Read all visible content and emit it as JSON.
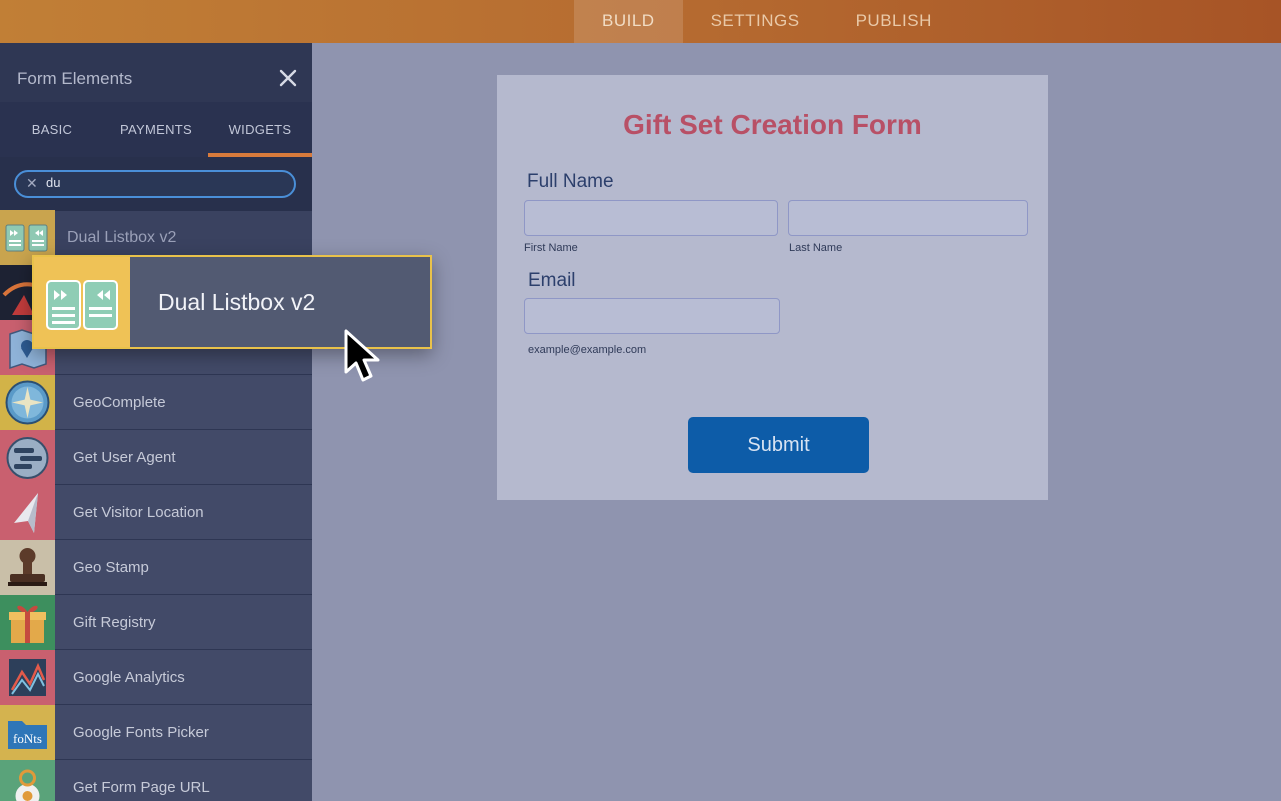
{
  "topnav": {
    "tabs": [
      {
        "label": "BUILD"
      },
      {
        "label": "SETTINGS"
      },
      {
        "label": "PUBLISH"
      }
    ],
    "active": "BUILD"
  },
  "sidebar": {
    "title": "Form Elements",
    "close_icon": "close-icon",
    "tabs": [
      {
        "label": "BASIC"
      },
      {
        "label": "PAYMENTS"
      },
      {
        "label": "WIDGETS"
      }
    ],
    "active_tab": "WIDGETS",
    "search": {
      "value": "du",
      "clear_icon": "clear-icon"
    },
    "items": [
      {
        "label": "Dual Listbox v2",
        "icon": "dual-listbox-icon"
      },
      {
        "label": "",
        "icon": "maps-icon"
      },
      {
        "label": "",
        "icon": "map-pin-icon"
      },
      {
        "label": "GeoComplete",
        "icon": "compass-icon"
      },
      {
        "label": "Get User Agent",
        "icon": "user-agent-icon"
      },
      {
        "label": "Get Visitor Location",
        "icon": "location-arrow-icon"
      },
      {
        "label": "Geo Stamp",
        "icon": "stamp-icon"
      },
      {
        "label": "Gift Registry",
        "icon": "gift-icon"
      },
      {
        "label": "Google Analytics",
        "icon": "analytics-icon"
      },
      {
        "label": "Google Fonts Picker",
        "icon": "fonts-folder-icon"
      },
      {
        "label": "Get Form Page URL",
        "icon": "url-pin-icon"
      }
    ]
  },
  "drag_ghost": {
    "label": "Dual Listbox v2",
    "icon": "dual-listbox-icon"
  },
  "cursor": {
    "icon": "cursor-arrow-icon"
  },
  "form": {
    "title": "Gift Set Creation Form",
    "full_name_label": "Full Name",
    "first_name_sublabel": "First Name",
    "last_name_sublabel": "Last Name",
    "email_label": "Email",
    "email_sublabel": "example@example.com",
    "submit_label": "Submit"
  },
  "colors": {
    "topbar": "#b56a30",
    "sidebar": "#343c59",
    "active_tab_underline": "#d87b3c",
    "search_border": "#4a8fd8",
    "form_title": "#b85066",
    "submit": "#0d5ca8",
    "ghost_border": "#e9c24a"
  }
}
